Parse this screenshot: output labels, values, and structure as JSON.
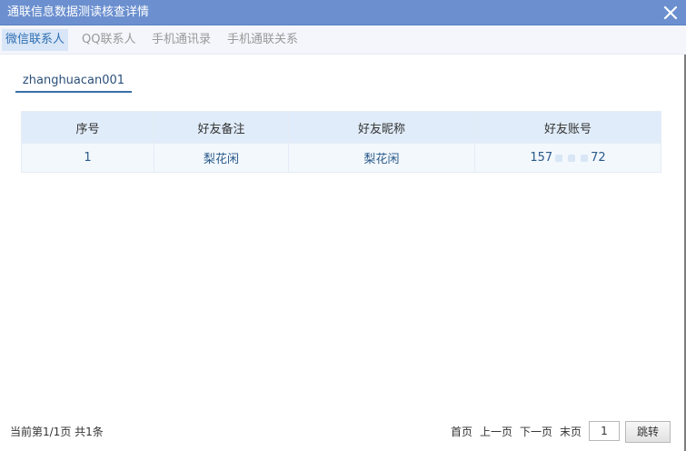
{
  "window": {
    "title": "通联信息数据测读核查详情"
  },
  "tabs": [
    {
      "label": "微信联系人",
      "active": true
    },
    {
      "label": "QQ联系人",
      "active": false
    },
    {
      "label": "手机通讯录",
      "active": false
    },
    {
      "label": "手机通联关系",
      "active": false
    }
  ],
  "account_tab": {
    "label": "zhanghuacan001"
  },
  "table": {
    "headers": [
      "序号",
      "好友备注",
      "好友昵称",
      "好友账号"
    ],
    "rows": [
      {
        "index": "1",
        "remark": "梨花闲",
        "nickname": "梨花闲",
        "account_prefix": "157",
        "account_suffix": "72"
      }
    ]
  },
  "footer": {
    "page_info": "当前第1/1页 共1条",
    "first": "首页",
    "prev": "上一页",
    "next": "下一页",
    "last": "末页",
    "page_value": "1",
    "jump_label": "跳转"
  },
  "icons": {
    "close": "close-icon"
  },
  "colors": {
    "titlebar": "#6b8fcf",
    "active_tab_bg": "#d9e6f7",
    "active_tab_text": "#2f6fb3",
    "table_header_bg": "#e0ecf9",
    "table_row_bg": "#f3f8fd",
    "account_underline": "#3a6fa8"
  }
}
